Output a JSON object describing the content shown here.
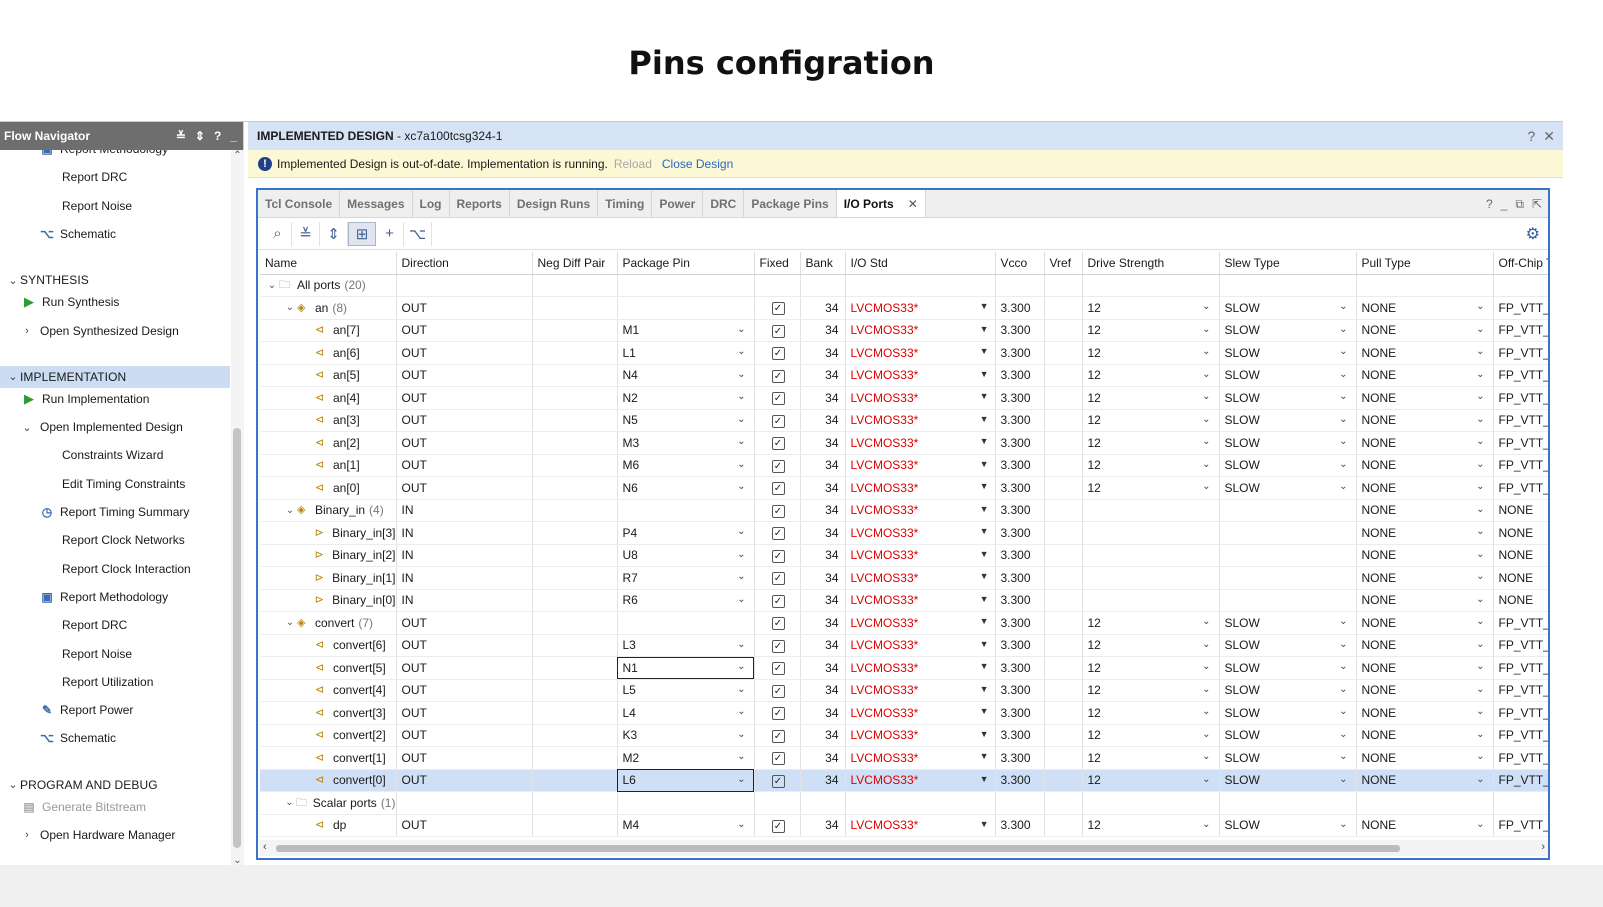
{
  "slide_title": "Pins configration",
  "flow_navigator": {
    "title": "Flow Navigator",
    "items": [
      {
        "label": "Report Methodology",
        "indent": 2,
        "icon": "methodology-icon"
      },
      {
        "label": "Report DRC",
        "indent": 3
      },
      {
        "label": "Report Noise",
        "indent": 3
      },
      {
        "label": "Schematic",
        "indent": 2,
        "icon": "schematic-icon"
      },
      {
        "label": "",
        "spacer": true
      },
      {
        "label": "SYNTHESIS",
        "section": true
      },
      {
        "label": "Run Synthesis",
        "indent": 1,
        "icon": "play-icon"
      },
      {
        "label": "Open Synthesized Design",
        "indent": 1,
        "chevron": "›"
      },
      {
        "label": "",
        "spacer": true
      },
      {
        "label": "IMPLEMENTATION",
        "section": true,
        "active": true
      },
      {
        "label": "Run Implementation",
        "indent": 1,
        "icon": "play-icon"
      },
      {
        "label": "Open Implemented Design",
        "indent": 1,
        "chevron": "⌄"
      },
      {
        "label": "Constraints Wizard",
        "indent": 3
      },
      {
        "label": "Edit Timing Constraints",
        "indent": 3
      },
      {
        "label": "Report Timing Summary",
        "indent": 2,
        "icon": "clock-icon"
      },
      {
        "label": "Report Clock Networks",
        "indent": 3
      },
      {
        "label": "Report Clock Interaction",
        "indent": 3
      },
      {
        "label": "Report Methodology",
        "indent": 2,
        "icon": "methodology-icon"
      },
      {
        "label": "Report DRC",
        "indent": 3
      },
      {
        "label": "Report Noise",
        "indent": 3
      },
      {
        "label": "Report Utilization",
        "indent": 3
      },
      {
        "label": "Report Power",
        "indent": 2,
        "icon": "power-icon"
      },
      {
        "label": "Schematic",
        "indent": 2,
        "icon": "schematic-icon"
      },
      {
        "label": "",
        "spacer": true
      },
      {
        "label": "PROGRAM AND DEBUG",
        "section": true
      },
      {
        "label": "Generate Bitstream",
        "indent": 1,
        "icon": "bitstream-icon",
        "disabled": true
      },
      {
        "label": "Open Hardware Manager",
        "indent": 1,
        "chevron": "›"
      }
    ]
  },
  "main": {
    "title": "IMPLEMENTED DESIGN",
    "subtitle": " - xc7a100tcsg324-1",
    "banner": {
      "message": "Implemented Design is out-of-date. Implementation is running.",
      "reload": "Reload",
      "close": "Close Design"
    },
    "tabs": [
      "Tcl Console",
      "Messages",
      "Log",
      "Reports",
      "Design Runs",
      "Timing",
      "Power",
      "DRC",
      "Package Pins",
      "I/O Ports"
    ],
    "active_tab": "I/O Ports",
    "columns": [
      "Name",
      "Direction",
      "Neg Diff Pair",
      "Package Pin",
      "Fixed",
      "Bank",
      "I/O Std",
      "Vcco",
      "Vref",
      "Drive Strength",
      "Slew Type",
      "Pull Type",
      "Off-Chip T"
    ]
  },
  "rows": [
    {
      "level": 0,
      "expand": "⌄",
      "name": "All ports",
      "count": "(20)",
      "icon": "folder-icon",
      "dir": "",
      "pin": "",
      "fixed": false,
      "bank": "",
      "iostd": "",
      "vcco": "",
      "drive": "",
      "slew": "",
      "pull": "",
      "off": "",
      "group_row": true
    },
    {
      "level": 1,
      "expand": "⌄",
      "name": "an",
      "count": "(8)",
      "icon": "bus-out-icon",
      "dir": "OUT",
      "pin": "",
      "fixed": true,
      "bank": "34",
      "iostd": "LVCMOS33*",
      "vcco": "3.300",
      "drive": "12",
      "slew": "SLOW",
      "pull": "NONE",
      "off": "FP_VTT_"
    },
    {
      "level": 2,
      "name": "an[7]",
      "icon": "port-out-icon",
      "dir": "OUT",
      "pin": "M1",
      "fixed": true,
      "bank": "34",
      "iostd": "LVCMOS33*",
      "vcco": "3.300",
      "drive": "12",
      "slew": "SLOW",
      "pull": "NONE",
      "off": "FP_VTT_"
    },
    {
      "level": 2,
      "name": "an[6]",
      "icon": "port-out-icon",
      "dir": "OUT",
      "pin": "L1",
      "fixed": true,
      "bank": "34",
      "iostd": "LVCMOS33*",
      "vcco": "3.300",
      "drive": "12",
      "slew": "SLOW",
      "pull": "NONE",
      "off": "FP_VTT_"
    },
    {
      "level": 2,
      "name": "an[5]",
      "icon": "port-out-icon",
      "dir": "OUT",
      "pin": "N4",
      "fixed": true,
      "bank": "34",
      "iostd": "LVCMOS33*",
      "vcco": "3.300",
      "drive": "12",
      "slew": "SLOW",
      "pull": "NONE",
      "off": "FP_VTT_"
    },
    {
      "level": 2,
      "name": "an[4]",
      "icon": "port-out-icon",
      "dir": "OUT",
      "pin": "N2",
      "fixed": true,
      "bank": "34",
      "iostd": "LVCMOS33*",
      "vcco": "3.300",
      "drive": "12",
      "slew": "SLOW",
      "pull": "NONE",
      "off": "FP_VTT_"
    },
    {
      "level": 2,
      "name": "an[3]",
      "icon": "port-out-icon",
      "dir": "OUT",
      "pin": "N5",
      "fixed": true,
      "bank": "34",
      "iostd": "LVCMOS33*",
      "vcco": "3.300",
      "drive": "12",
      "slew": "SLOW",
      "pull": "NONE",
      "off": "FP_VTT_"
    },
    {
      "level": 2,
      "name": "an[2]",
      "icon": "port-out-icon",
      "dir": "OUT",
      "pin": "M3",
      "fixed": true,
      "bank": "34",
      "iostd": "LVCMOS33*",
      "vcco": "3.300",
      "drive": "12",
      "slew": "SLOW",
      "pull": "NONE",
      "off": "FP_VTT_"
    },
    {
      "level": 2,
      "name": "an[1]",
      "icon": "port-out-icon",
      "dir": "OUT",
      "pin": "M6",
      "fixed": true,
      "bank": "34",
      "iostd": "LVCMOS33*",
      "vcco": "3.300",
      "drive": "12",
      "slew": "SLOW",
      "pull": "NONE",
      "off": "FP_VTT_"
    },
    {
      "level": 2,
      "name": "an[0]",
      "icon": "port-out-icon",
      "dir": "OUT",
      "pin": "N6",
      "fixed": true,
      "bank": "34",
      "iostd": "LVCMOS33*",
      "vcco": "3.300",
      "drive": "12",
      "slew": "SLOW",
      "pull": "NONE",
      "off": "FP_VTT_"
    },
    {
      "level": 1,
      "expand": "⌄",
      "name": "Binary_in",
      "count": "(4)",
      "icon": "bus-in-icon",
      "dir": "IN",
      "pin": "",
      "fixed": true,
      "bank": "34",
      "iostd": "LVCMOS33*",
      "vcco": "3.300",
      "drive": "",
      "slew": "",
      "pull": "NONE",
      "off": "NONE"
    },
    {
      "level": 2,
      "name": "Binary_in[3]",
      "icon": "port-in-icon",
      "dir": "IN",
      "pin": "P4",
      "fixed": true,
      "bank": "34",
      "iostd": "LVCMOS33*",
      "vcco": "3.300",
      "drive": "",
      "slew": "",
      "pull": "NONE",
      "off": "NONE"
    },
    {
      "level": 2,
      "name": "Binary_in[2]",
      "icon": "port-in-icon",
      "dir": "IN",
      "pin": "U8",
      "fixed": true,
      "bank": "34",
      "iostd": "LVCMOS33*",
      "vcco": "3.300",
      "drive": "",
      "slew": "",
      "pull": "NONE",
      "off": "NONE"
    },
    {
      "level": 2,
      "name": "Binary_in[1]",
      "icon": "port-in-icon",
      "dir": "IN",
      "pin": "R7",
      "fixed": true,
      "bank": "34",
      "iostd": "LVCMOS33*",
      "vcco": "3.300",
      "drive": "",
      "slew": "",
      "pull": "NONE",
      "off": "NONE"
    },
    {
      "level": 2,
      "name": "Binary_in[0]",
      "icon": "port-in-icon",
      "dir": "IN",
      "pin": "R6",
      "fixed": true,
      "bank": "34",
      "iostd": "LVCMOS33*",
      "vcco": "3.300",
      "drive": "",
      "slew": "",
      "pull": "NONE",
      "off": "NONE"
    },
    {
      "level": 1,
      "expand": "⌄",
      "name": "convert",
      "count": "(7)",
      "icon": "bus-out-icon",
      "dir": "OUT",
      "pin": "",
      "fixed": true,
      "bank": "34",
      "iostd": "LVCMOS33*",
      "vcco": "3.300",
      "drive": "12",
      "slew": "SLOW",
      "pull": "NONE",
      "off": "FP_VTT_"
    },
    {
      "level": 2,
      "name": "convert[6]",
      "icon": "port-out-icon",
      "dir": "OUT",
      "pin": "L3",
      "fixed": true,
      "bank": "34",
      "iostd": "LVCMOS33*",
      "vcco": "3.300",
      "drive": "12",
      "slew": "SLOW",
      "pull": "NONE",
      "off": "FP_VTT_"
    },
    {
      "level": 2,
      "name": "convert[5]",
      "icon": "port-out-icon",
      "dir": "OUT",
      "pin": "N1",
      "fixed": true,
      "bank": "34",
      "iostd": "LVCMOS33*",
      "vcco": "3.300",
      "drive": "12",
      "slew": "SLOW",
      "pull": "NONE",
      "off": "FP_VTT_",
      "pin_boxed": true
    },
    {
      "level": 2,
      "name": "convert[4]",
      "icon": "port-out-icon",
      "dir": "OUT",
      "pin": "L5",
      "fixed": true,
      "bank": "34",
      "iostd": "LVCMOS33*",
      "vcco": "3.300",
      "drive": "12",
      "slew": "SLOW",
      "pull": "NONE",
      "off": "FP_VTT_"
    },
    {
      "level": 2,
      "name": "convert[3]",
      "icon": "port-out-icon",
      "dir": "OUT",
      "pin": "L4",
      "fixed": true,
      "bank": "34",
      "iostd": "LVCMOS33*",
      "vcco": "3.300",
      "drive": "12",
      "slew": "SLOW",
      "pull": "NONE",
      "off": "FP_VTT_"
    },
    {
      "level": 2,
      "name": "convert[2]",
      "icon": "port-out-icon",
      "dir": "OUT",
      "pin": "K3",
      "fixed": true,
      "bank": "34",
      "iostd": "LVCMOS33*",
      "vcco": "3.300",
      "drive": "12",
      "slew": "SLOW",
      "pull": "NONE",
      "off": "FP_VTT_"
    },
    {
      "level": 2,
      "name": "convert[1]",
      "icon": "port-out-icon",
      "dir": "OUT",
      "pin": "M2",
      "fixed": true,
      "bank": "34",
      "iostd": "LVCMOS33*",
      "vcco": "3.300",
      "drive": "12",
      "slew": "SLOW",
      "pull": "NONE",
      "off": "FP_VTT_"
    },
    {
      "level": 2,
      "name": "convert[0]",
      "icon": "port-out-icon",
      "dir": "OUT",
      "pin": "L6",
      "fixed": true,
      "bank": "34",
      "iostd": "LVCMOS33*",
      "vcco": "3.300",
      "drive": "12",
      "slew": "SLOW",
      "pull": "NONE",
      "off": "FP_VTT_",
      "selected": true,
      "pin_boxed": true
    },
    {
      "level": 1,
      "expand": "⌄",
      "name": "Scalar ports",
      "count": "(1)",
      "icon": "folder-icon",
      "dir": "",
      "pin": "",
      "fixed": false,
      "bank": "",
      "iostd": "",
      "vcco": "",
      "drive": "",
      "slew": "",
      "pull": "",
      "off": "",
      "group_row": true
    },
    {
      "level": 2,
      "name": "dp",
      "icon": "port-out-icon",
      "dir": "OUT",
      "pin": "M4",
      "fixed": true,
      "bank": "34",
      "iostd": "LVCMOS33*",
      "vcco": "3.300",
      "drive": "12",
      "slew": "SLOW",
      "pull": "NONE",
      "off": "FP_VTT_"
    }
  ],
  "colors": {
    "accent": "#3a74c9",
    "selected_row": "#cfdff5",
    "iostd_text": "#dd0000",
    "banner_bg": "#fcf8d6"
  }
}
